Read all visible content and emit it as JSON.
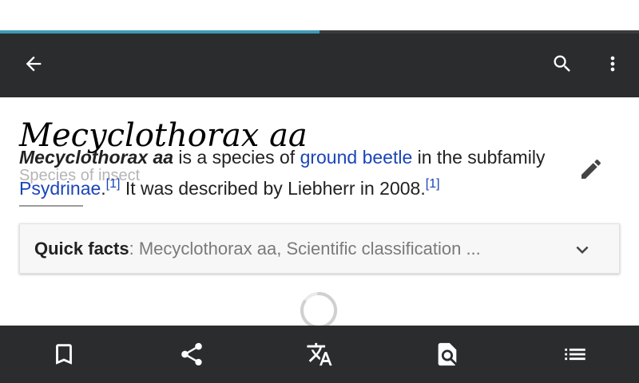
{
  "loading": {
    "progress": 0.5
  },
  "toolbar": {
    "back_icon": "arrow-back-icon",
    "search_icon": "search-icon",
    "more_icon": "more-vert-icon"
  },
  "article": {
    "title": "Mecyclothorax aa",
    "subtitle": "Species of insect",
    "lead": {
      "subject": "Mecyclothorax aa",
      "text1": " is a species of ",
      "link1": "ground beetle",
      "text2": " in the subfamily ",
      "link2": "Psydrinae",
      "text3": ".",
      "ref1": "[1]",
      "text4": " It was described by Liebherr in 2008.",
      "ref2": "[1]"
    },
    "edit_icon": "pencil-icon"
  },
  "quick_facts": {
    "label": "Quick facts",
    "summary": ": Mecyclothorax aa, Scientific classification ...",
    "icon": "chevron-down-icon"
  },
  "bottom_bar": {
    "items": [
      {
        "icon": "bookmark-icon"
      },
      {
        "icon": "share-icon"
      },
      {
        "icon": "translate-icon"
      },
      {
        "icon": "find-in-page-icon"
      },
      {
        "icon": "contents-list-icon"
      }
    ]
  },
  "colors": {
    "toolbar_bg": "#2b2c2e",
    "progress": "#3d9bb8",
    "link": "#1a44b8",
    "card_bg": "#f7f7f7"
  }
}
